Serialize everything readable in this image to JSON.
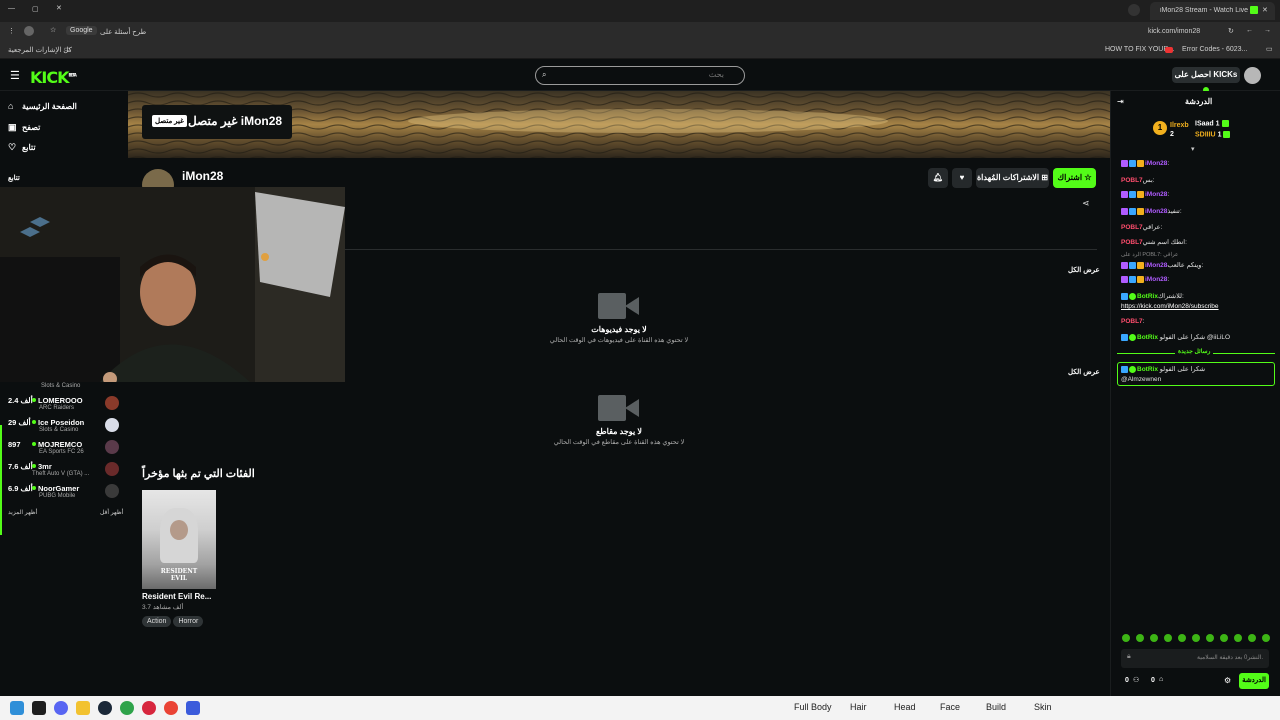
{
  "browser": {
    "tab_title": "iMon28 Stream - Watch Live on...",
    "url": "kick.com/imon28",
    "google_button": "Google",
    "ask_label": "طرح أسئلة على",
    "bookmarks_left": "كل الإشارات المرجعية",
    "bookmark_1": "HOW TO FIX YOUR...",
    "bookmark_2": "Error Codes - 6023..."
  },
  "header": {
    "logo": "KICK",
    "logo_sup": "BETA",
    "search_placeholder": "بحث",
    "kicks_button": "احصل على KICKs"
  },
  "sidebar": {
    "nav": [
      {
        "label": "الصفحة الرئيسية",
        "icon": "home-icon"
      },
      {
        "label": "تصفح",
        "icon": "browse-icon"
      },
      {
        "label": "تتابع",
        "icon": "heart-icon"
      }
    ],
    "section": "تتابع",
    "partial_game": "Slots & Casino",
    "streamers": [
      {
        "viewers": "2.4 ألف",
        "name": "LOMEROOO",
        "game": "ARC Raiders"
      },
      {
        "viewers": "29 ألف",
        "name": "Ice Poseidon",
        "game": "Slots & Casino"
      },
      {
        "viewers": "897",
        "name": "MOJREMCO",
        "game": "EA Sports FC 26"
      },
      {
        "viewers": "7.6 ألف",
        "name": "3mr",
        "game": "Theft Auto V (GTA) ..."
      },
      {
        "viewers": "6.9 ألف",
        "name": "NoorGamer",
        "game": "PUBG Mobile"
      }
    ],
    "show_more": "أظهر المزيد",
    "show_less": "أظهر أقل"
  },
  "channel": {
    "offline_badge": "غير متصل",
    "offline_title": "غير متصل iMon28",
    "name": "iMon28",
    "subscribe_button": "اشتراك",
    "gift_button": "الاشتراكات المُهداة",
    "show_all_1": "عرض الكل",
    "show_all_2": "عرض الكل",
    "no_videos_title": "لا يوجد فيديوهات",
    "no_videos_sub": "لا تحتوي هذه القناة على فيديوهات في الوقت الحالي",
    "no_clips_title": "لا يوجد مقاطع",
    "no_clips_sub": "لا تحتوي هذه القناة على مقاطع في الوقت الحالي",
    "recent_title": "الفئات التي تم بثها مؤخراً",
    "recent_card": {
      "title": "Resident Evil Re...",
      "views": "3.7 ألف مشاهد",
      "tags": [
        "Action",
        "Horror"
      ],
      "art_text": "RESIDENT EVIL"
    }
  },
  "chat": {
    "title": "الدردشة",
    "leaders": [
      {
        "rank": "1",
        "name": "ISaad",
        "count": "1"
      },
      {
        "rank": "",
        "name": "Ilrexb",
        "count": "1"
      },
      {
        "rank": "",
        "name": "SDIIIU",
        "count": "1"
      },
      {
        "rank": "",
        "name": "",
        "count": "2"
      }
    ],
    "messages": [
      {
        "user": "iMon28",
        "text": ":"
      },
      {
        "user": "POBL7",
        "text": "بس:"
      },
      {
        "user": "iMon28",
        "text": ":"
      },
      {
        "user": "iMon28",
        "text": "تنفيذ:"
      },
      {
        "user": "POBL7",
        "text": "عراقي:"
      },
      {
        "user": "POBL7",
        "text": "انطك اسم شني:"
      },
      {
        "user": "",
        "text": "الرد على POBL7: عراقي"
      },
      {
        "user": "iMon28",
        "text": "وينكم عالعب:"
      },
      {
        "user": "iMon28",
        "text": ":"
      },
      {
        "user": "BotRix",
        "text": "للاشتراك:"
      },
      {
        "user": "",
        "text": "https://kick.com/iMon28/subscribe"
      },
      {
        "user": "POBL7",
        "text": ":"
      },
      {
        "user": "BotRix",
        "text": "شكرا على الفولو @iiLiLO"
      }
    ],
    "new_messages": "رسائل جديدة",
    "pinned_user": "BotRix",
    "pinned_text": "شكرا على الفولو",
    "pinned_mention": "@Almzewnen",
    "input_placeholder": "النشر0 بعد دقيقة السلامية.",
    "counter_1": "0",
    "counter_2": "0",
    "send_button": "الدردشة"
  },
  "taskbar": {
    "tabs": [
      "Full Body",
      "Hair",
      "Head",
      "Face",
      "Build",
      "Skin"
    ]
  },
  "colors": {
    "accent": "#53fc18",
    "background": "#0b0e0f",
    "username": "#b05cff"
  }
}
